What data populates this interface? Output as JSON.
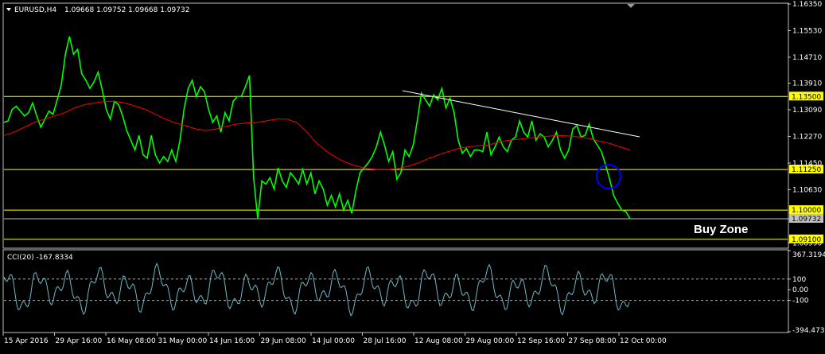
{
  "header": {
    "symbol_label": "EURUSD,H4",
    "ohlc_label": "1.09668 1.09752 1.09668 1.09732"
  },
  "colors": {
    "background": "#000000",
    "frame": "#c0c0c0",
    "price": "#00ff00",
    "ma": "#ff0000",
    "levels": "#ffff00",
    "trendline": "#ffffff",
    "circle": "#0000ff",
    "cci": "#6fb8c8",
    "cci_levels": "#b0b0b0",
    "current_price": "#c0c0c0"
  },
  "chart_data": [
    {
      "type": "line",
      "title": "EURUSD,H4",
      "x_tick_labels": [
        "15 Apr 2016",
        "29 Apr 16:00",
        "16 May 08:00",
        "31 May 00:00",
        "14 Jun 16:00",
        "29 Jun 08:00",
        "14 Jul 00:00",
        "28 Jul 16:00",
        "12 Aug 08:00",
        "29 Aug 00:00",
        "12 Sep 16:00",
        "27 Sep 08:00",
        "12 Oct 00:00"
      ],
      "x": [
        0,
        4,
        8,
        12,
        16,
        20,
        24,
        28,
        32,
        36,
        40,
        44,
        48,
        52,
        56,
        60,
        64,
        68,
        72,
        76,
        80,
        84,
        88,
        92,
        96,
        100,
        104,
        108,
        112,
        116,
        120,
        124,
        128,
        132,
        136,
        140,
        144,
        148,
        152,
        156,
        160,
        164,
        168,
        172,
        176,
        180,
        184,
        188,
        192,
        196,
        200,
        204,
        208,
        212,
        216,
        220,
        224,
        228,
        232,
        236,
        240,
        244,
        248,
        252,
        256,
        260,
        264,
        268,
        272,
        276,
        280,
        284,
        288,
        292,
        296,
        300,
        304,
        308,
        312,
        316,
        320,
        324,
        328,
        332,
        336,
        340,
        344,
        348,
        352,
        356,
        360,
        364,
        368,
        372,
        376,
        380,
        384,
        388,
        392,
        396,
        400,
        404,
        408,
        412,
        416,
        420,
        424,
        428,
        432,
        436,
        440,
        444,
        448,
        452,
        456,
        460,
        464,
        468,
        472,
        476,
        480,
        484,
        488,
        492,
        496,
        500,
        504,
        508,
        512,
        516,
        520,
        524,
        528,
        532,
        536,
        540,
        544,
        548,
        552,
        556,
        560,
        564,
        568,
        572,
        576,
        580,
        584,
        588,
        592,
        596,
        600,
        604,
        608,
        612,
        616,
        620,
        624,
        628,
        632,
        636,
        640,
        644,
        648,
        652,
        656,
        660,
        664,
        668,
        672,
        676,
        680,
        684,
        688,
        692,
        696,
        700,
        704,
        708,
        712,
        716,
        720,
        724,
        728,
        732,
        736,
        740,
        744,
        748,
        752,
        756,
        760,
        764,
        768,
        772,
        776,
        780,
        784,
        788
      ],
      "y_tick_labels": [
        "1.16350",
        "1.15530",
        "1.14710",
        "1.13910",
        "1.13090",
        "1.12270",
        "1.11450",
        "1.10630",
        "1.09732",
        "1.08990"
      ],
      "ylim": [
        1.0885,
        1.1635
      ],
      "series": [
        {
          "values": [
            1.127,
            1.1275,
            1.131,
            1.132,
            1.1305,
            1.129,
            1.13,
            1.133,
            1.129,
            1.1255,
            1.128,
            1.1305,
            1.1295,
            1.134,
            1.1385,
            1.148,
            1.1535,
            1.148,
            1.1495,
            1.142,
            1.14,
            1.1375,
            1.1395,
            1.1425,
            1.137,
            1.131,
            1.128,
            1.1335,
            1.1325,
            1.129,
            1.1245,
            1.1215,
            1.1185,
            1.123,
            1.117,
            1.116,
            1.123,
            1.117,
            1.1145,
            1.1165,
            1.115,
            1.1185,
            1.115,
            1.1215,
            1.131,
            1.1375,
            1.14,
            1.135,
            1.138,
            1.1365,
            1.131,
            1.127,
            1.129,
            1.124,
            1.13,
            1.1275,
            1.1335,
            1.135,
            1.135,
            1.138,
            1.1415,
            1.11,
            1.0975,
            1.109,
            1.108,
            1.11,
            1.1065,
            1.113,
            1.109,
            1.107,
            1.1115,
            1.11,
            1.108,
            1.1125,
            1.108,
            1.1115,
            1.105,
            1.109,
            1.1065,
            1.1015,
            1.1045,
            1.101,
            1.105,
            1.1,
            1.103,
            1.099,
            1.106,
            1.1115,
            1.113,
            1.1145,
            1.1165,
            1.1195,
            1.124,
            1.12,
            1.115,
            1.118,
            1.1095,
            1.1115,
            1.1185,
            1.1165,
            1.12,
            1.1275,
            1.136,
            1.134,
            1.132,
            1.1355,
            1.134,
            1.1375,
            1.1315,
            1.1345,
            1.13,
            1.1215,
            1.1175,
            1.119,
            1.1165,
            1.1185,
            1.1185,
            1.118,
            1.124,
            1.117,
            1.1195,
            1.1225,
            1.1195,
            1.118,
            1.1215,
            1.1225,
            1.1275,
            1.124,
            1.1225,
            1.1275,
            1.1215,
            1.1235,
            1.1225,
            1.1195,
            1.1215,
            1.124,
            1.1185,
            1.116,
            1.1185,
            1.125,
            1.126,
            1.1225,
            1.123,
            1.1265,
            1.122,
            1.12,
            1.118,
            1.114,
            1.1095,
            1.1045,
            1.102,
            1.1,
            1.0995,
            1.0973
          ]
        },
        {
          "values": [
            1.123,
            1.124,
            1.1255,
            1.127,
            1.128,
            1.129,
            1.13,
            1.1315,
            1.1325,
            1.133,
            1.1335,
            1.1335,
            1.133,
            1.132,
            1.131,
            1.1295,
            1.128,
            1.1268,
            1.126,
            1.125,
            1.1245,
            1.125,
            1.1258,
            1.1265,
            1.1268,
            1.127,
            1.1275,
            1.128,
            1.128,
            1.127,
            1.124,
            1.1205,
            1.118,
            1.116,
            1.1145,
            1.1135,
            1.1128,
            1.1125,
            1.1125,
            1.1128,
            1.1135,
            1.1145,
            1.1158,
            1.117,
            1.118,
            1.119,
            1.1195,
            1.1198,
            1.12,
            1.121,
            1.1215,
            1.1218,
            1.1222,
            1.1225,
            1.1228,
            1.123,
            1.1228,
            1.1225,
            1.122,
            1.1212,
            1.1205,
            1.1195,
            1.1185
          ]
        }
      ]
    },
    {
      "type": "line",
      "title": "CCI(20) -167.8334",
      "y_tick_labels": [
        "367.3194",
        "100",
        "0.00",
        "-100",
        "-394.4731"
      ],
      "ylim": [
        -394.4731,
        367.3194
      ],
      "levels": [
        100,
        -100
      ]
    }
  ],
  "levels": {
    "upper": "1.13500",
    "middle": "1.11250",
    "lower": "1.10000",
    "bottom": "1.09100",
    "current": "1.09732"
  },
  "annotations": {
    "buy_zone": "Buy Zone"
  }
}
